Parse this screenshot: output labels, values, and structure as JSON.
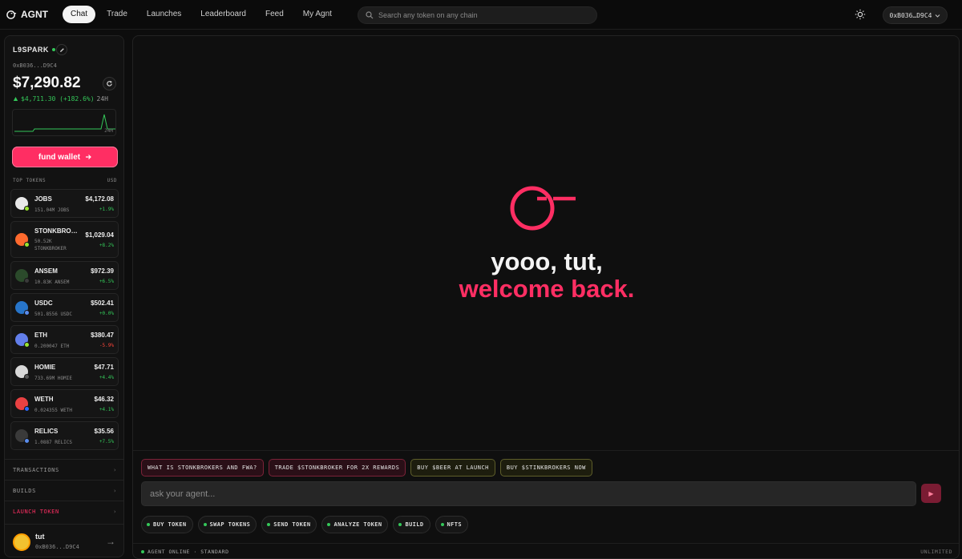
{
  "brand": {
    "name": "AGNT"
  },
  "nav": [
    {
      "label": "Chat",
      "active": true
    },
    {
      "label": "Trade"
    },
    {
      "label": "Launches"
    },
    {
      "label": "Leaderboard"
    },
    {
      "label": "Feed"
    },
    {
      "label": "My Agnt"
    }
  ],
  "search": {
    "placeholder": "Search any token on any chain"
  },
  "wallet": {
    "address": "0xB036…D9C4"
  },
  "account": {
    "name": "L9SPARK",
    "address": "0xB036...D9C4",
    "balance": "$7,290.82",
    "change": "$4,711.30 (+182.6%)",
    "period": "24H",
    "spark_label": "24H",
    "fund_label": "fund wallet"
  },
  "tokens_header": {
    "left": "TOP TOKENS",
    "right": "USD"
  },
  "tokens": [
    {
      "symbol": "JOBS",
      "amount": "151.04M JOBS",
      "value": "$4,172.08",
      "change": "+1.9%",
      "dir": "pos",
      "color": "#e8e8e8",
      "badge": "#9ae630"
    },
    {
      "symbol": "STONKBRO…",
      "amount": "50.52K STONKBROKER",
      "value": "$1,029.04",
      "change": "+8.2%",
      "dir": "pos",
      "color": "#ff6a2e",
      "badge": "#9ae630",
      "tall": true
    },
    {
      "symbol": "ANSEM",
      "amount": "10.83K ANSEM",
      "value": "$972.39",
      "change": "+6.5%",
      "dir": "pos",
      "color": "#2b4a2b",
      "badge": "#3a3a3a"
    },
    {
      "symbol": "USDC",
      "amount": "501.8556 USDC",
      "value": "$502.41",
      "change": "+0.0%",
      "dir": "pos",
      "color": "#2775ca",
      "badge": "#5a8dee"
    },
    {
      "symbol": "ETH",
      "amount": "0.200047 ETH",
      "value": "$380.47",
      "change": "-5.9%",
      "dir": "neg",
      "color": "#627eea",
      "badge": "#9ae630"
    },
    {
      "symbol": "HOMIE",
      "amount": "733.69M HOMIE",
      "value": "$47.71",
      "change": "+4.4%",
      "dir": "pos",
      "color": "#d8d8d8",
      "badge": "#555555"
    },
    {
      "symbol": "WETH",
      "amount": "0.024355 WETH",
      "value": "$46.32",
      "change": "+4.1%",
      "dir": "pos",
      "color": "#e84142",
      "badge": "#2d6bff"
    },
    {
      "symbol": "RELICS",
      "amount": "1.0887 RELICS",
      "value": "$35.56",
      "change": "+7.5%",
      "dir": "pos",
      "color": "#3a3a3a",
      "badge": "#5a8dee"
    }
  ],
  "sections": [
    {
      "label": "TRANSACTIONS"
    },
    {
      "label": "BUILDS"
    },
    {
      "label": "LAUNCH TOKEN"
    }
  ],
  "user": {
    "name": "tut",
    "address": "0xB036...D9C4"
  },
  "hero": {
    "line1": "yooo, tut,",
    "line2": "welcome back."
  },
  "suggestions": [
    {
      "label": "WHAT IS STONKBROKERS AND FWA?",
      "style": "pink"
    },
    {
      "label": "TRADE $STONKBROKER FOR 2X REWARDS",
      "style": "pink"
    },
    {
      "label": "BUY $BEER AT LAUNCH",
      "style": "yel"
    },
    {
      "label": "BUY $STINKBROKERS NOW",
      "style": "yel"
    }
  ],
  "chat": {
    "placeholder": "ask your agent..."
  },
  "actions": [
    {
      "label": "BUY TOKEN"
    },
    {
      "label": "SWAP TOKENS"
    },
    {
      "label": "SEND TOKEN"
    },
    {
      "label": "ANALYZE TOKEN"
    },
    {
      "label": "BUILD"
    },
    {
      "label": "NFTS"
    }
  ],
  "status": {
    "left": "AGENT ONLINE · STANDARD",
    "right": "UNLIMITED"
  },
  "colors": {
    "accent": "#ff2e63",
    "positive": "#34c759",
    "negative": "#ff453a"
  }
}
